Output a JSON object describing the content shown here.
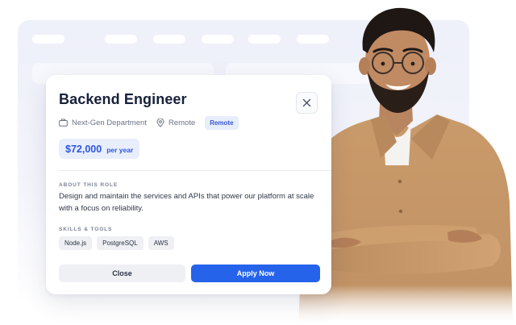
{
  "job": {
    "title": "Backend Engineer",
    "department": "Next-Gen Department",
    "location": "Remote",
    "work_type_badge": "Remote",
    "salary_amount": "$72,000",
    "salary_period": "per year",
    "about_label": "ABOUT THIS ROLE",
    "description_line1": "Design and maintain the services and APIs that power our platform at scale",
    "description_line2": "with a focus on reliability.",
    "skills_label": "SKILLS & TOOLS",
    "skills": [
      "Node.js",
      "PostgreSQL",
      "AWS"
    ]
  },
  "actions": {
    "close_label": "Close",
    "apply_label": "Apply Now"
  },
  "icons": {
    "close": "close-icon",
    "department": "briefcase-icon",
    "location": "location-pin-icon"
  },
  "colors": {
    "accent": "#2563eb",
    "salary_bg": "#e9eefc",
    "badge_bg": "#e8edfb",
    "title": "#16203a"
  }
}
